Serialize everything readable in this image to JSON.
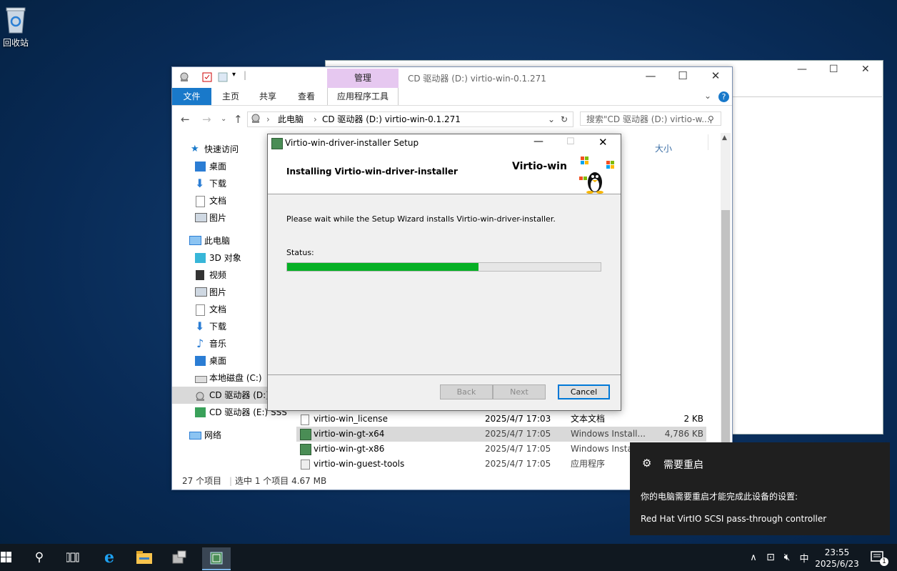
{
  "desktop": {
    "recycle_bin_label": "回收站"
  },
  "explorer": {
    "context_tab": "管理",
    "window_title": "CD 驱动器 (D:) virtio-win-0.1.271",
    "tabs": {
      "file": "文件",
      "home": "主页",
      "share": "共享",
      "view": "查看",
      "app_tools": "应用程序工具"
    },
    "breadcrumb": {
      "this_pc": "此电脑",
      "drive": "CD 驱动器 (D:) virtio-win-0.1.271"
    },
    "search_placeholder": "搜索\"CD 驱动器 (D:) virtio-w...",
    "column_size": "大小",
    "nav": {
      "quick_access": "快速访问",
      "qa_desktop": "桌面",
      "qa_downloads": "下载",
      "qa_documents": "文档",
      "qa_pictures": "图片",
      "this_pc": "此电脑",
      "objects3d": "3D 对象",
      "videos": "视频",
      "pictures": "图片",
      "documents": "文档",
      "downloads": "下载",
      "music": "音乐",
      "desktop": "桌面",
      "local_disk": "本地磁盘 (C:)",
      "cd_d": "CD 驱动器 (D:)",
      "cd_e": "CD 驱动器 (E:) SSS",
      "network": "网络"
    },
    "files": [
      {
        "name": "virtio-win_license",
        "date": "2025/4/7 17:03",
        "type": "文本文档",
        "size": "2 KB"
      },
      {
        "name": "virtio-win-gt-x64",
        "date": "2025/4/7 17:05",
        "type": "Windows Install...",
        "size": "4,786 KB"
      },
      {
        "name": "virtio-win-gt-x86",
        "date": "2025/4/7 17:05",
        "type": "Windows Insta",
        "size": ""
      },
      {
        "name": "virtio-win-guest-tools",
        "date": "2025/4/7 17:05",
        "type": "应用程序",
        "size": ""
      }
    ],
    "status": {
      "count": "27 个项目",
      "selection": "选中 1 个项目  4.67 MB"
    }
  },
  "setup": {
    "title": "Virtio-win-driver-installer Setup",
    "heading": "Installing Virtio-win-driver-installer",
    "brand": "Virtio-win",
    "message": "Please wait while the Setup Wizard installs Virtio-win-driver-installer.",
    "status_label": "Status:",
    "progress": 0.61,
    "buttons": {
      "back": "Back",
      "next": "Next",
      "cancel": "Cancel"
    }
  },
  "toast": {
    "title": "需要重启",
    "body": "你的电脑需要重启才能完成此设备的设置:",
    "device": "Red Hat VirtIO SCSI pass-through controller"
  },
  "taskbar": {
    "ime": "中",
    "time": "23:55",
    "date": "2025/6/23",
    "notification_count": "1"
  },
  "colors": {
    "progress": "#06b025",
    "file_tab": "#1979ca",
    "context_tab": "#e6c8f0"
  }
}
